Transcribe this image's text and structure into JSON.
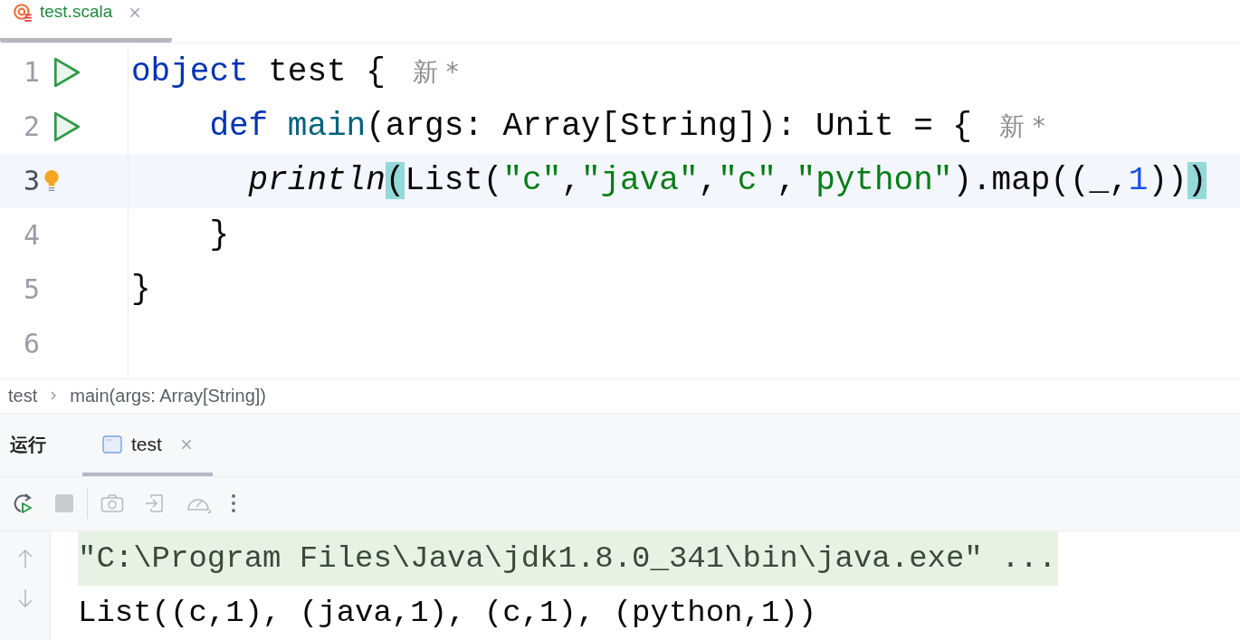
{
  "editor_tabs": [
    {
      "label": "test.scala",
      "selected": true
    }
  ],
  "code_lines": [
    {
      "number": "1",
      "run_gutter": true,
      "bulb": false,
      "current": false,
      "tokens": [
        {
          "kind": "keyword",
          "text": "object"
        },
        {
          "kind": "plain",
          "text": " test {"
        }
      ],
      "hint": "新 *",
      "children": [
        {
          "number": "2",
          "run_gutter": true,
          "bulb": false,
          "current": false,
          "tokens": [
            {
              "kind": "keyword",
              "text": "def "
            },
            {
              "kind": "function",
              "text": "main"
            },
            {
              "kind": "plain",
              "text": "(args: Array[String]): Unit = {"
            }
          ],
          "hint": "新 *",
          "children": [
            {
              "number": "3",
              "run_gutter": false,
              "bulb": true,
              "current": true,
              "tokens": [
                {
                  "kind": "italic",
                  "text": "println"
                },
                {
                  "kind": "match",
                  "text": "("
                },
                {
                  "kind": "plain",
                  "text": "List("
                },
                {
                  "kind": "string",
                  "text": "\"c\""
                },
                {
                  "kind": "plain",
                  "text": ","
                },
                {
                  "kind": "string",
                  "text": "\"java\""
                },
                {
                  "kind": "plain",
                  "text": ","
                },
                {
                  "kind": "string",
                  "text": "\"c\""
                },
                {
                  "kind": "plain",
                  "text": ","
                },
                {
                  "kind": "string",
                  "text": "\"python\""
                },
                {
                  "kind": "plain",
                  "text": ").map((_,"
                },
                {
                  "kind": "number",
                  "text": "1"
                },
                {
                  "kind": "plain",
                  "text": "))"
                },
                {
                  "kind": "match",
                  "text": ")"
                }
              ]
            }
          ]
        },
        {
          "number": "4",
          "run_gutter": false,
          "bulb": false,
          "current": false,
          "tokens": [
            {
              "kind": "plain",
              "text": "}"
            }
          ]
        }
      ]
    },
    {
      "number": "5",
      "run_gutter": false,
      "bulb": false,
      "current": false,
      "tokens": [
        {
          "kind": "plain",
          "text": "}"
        }
      ]
    },
    {
      "number": "6",
      "run_gutter": false,
      "bulb": false,
      "current": false
    }
  ],
  "breadcrumbs": [
    "test",
    "main(args: Array[String])"
  ],
  "run_panel": {
    "title": "运行",
    "tabs": [
      {
        "label": "test",
        "selected": true
      }
    ]
  },
  "console": [
    {
      "kind": "command",
      "text": "\"C:\\Program Files\\Java\\jdk1.8.0_341\\bin\\java.exe\" ..."
    },
    {
      "kind": "output",
      "text": "List((c,1), (java,1), (c,1), (python,1))"
    }
  ]
}
